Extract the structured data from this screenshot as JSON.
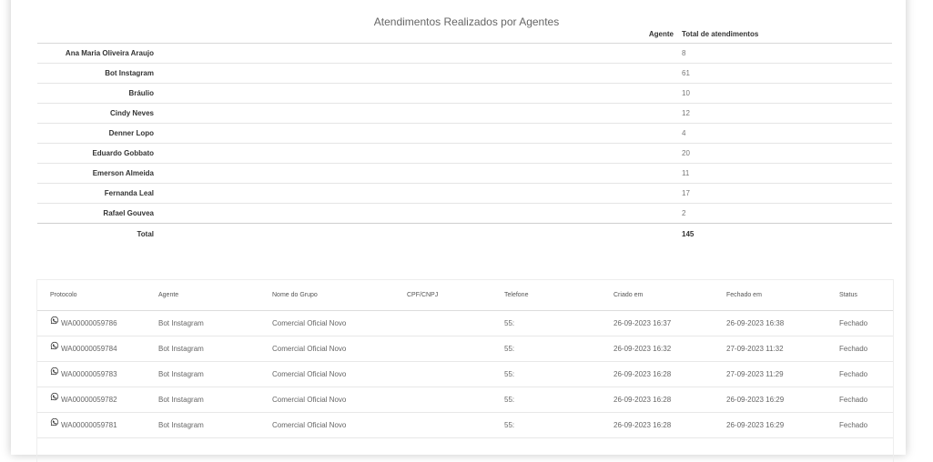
{
  "report_title": "Atendimentos Realizados por Agentes",
  "summary": {
    "headers": {
      "agent": "Agente",
      "total": "Total de atendimentos"
    },
    "rows": [
      {
        "name": "Ana Maria Oliveira Araujo",
        "total": "8"
      },
      {
        "name": "Bot Instagram",
        "total": "61"
      },
      {
        "name": "Bráulio",
        "total": "10"
      },
      {
        "name": "Cindy Neves",
        "total": "12"
      },
      {
        "name": "Denner Lopo",
        "total": "4"
      },
      {
        "name": "Eduardo Gobbato",
        "total": "20"
      },
      {
        "name": "Emerson Almeida",
        "total": "11"
      },
      {
        "name": "Fernanda Leal",
        "total": "17"
      },
      {
        "name": "Rafael Gouvea",
        "total": "2"
      }
    ],
    "total_label": "Total",
    "total_value": "145"
  },
  "detail": {
    "headers": {
      "protocolo": "Protocolo",
      "agente": "Agente",
      "grupo": "Nome do Grupo",
      "cpf": "CPF/CNPJ",
      "telefone": "Telefone",
      "criado": "Criado em",
      "fechado": "Fechado em",
      "status": "Status"
    },
    "icon": "whatsapp-icon",
    "rows": [
      {
        "protocolo": "WA00000059786",
        "agente": "Bot Instagram",
        "grupo": "Comercial Oficial Novo",
        "cpf": "",
        "telefone": "55:",
        "criado": "26-09-2023 16:37",
        "fechado": "26-09-2023 16:38",
        "status": "Fechado"
      },
      {
        "protocolo": "WA00000059784",
        "agente": "Bot Instagram",
        "grupo": "Comercial Oficial Novo",
        "cpf": "",
        "telefone": "55:",
        "criado": "26-09-2023 16:32",
        "fechado": "27-09-2023 11:32",
        "status": "Fechado"
      },
      {
        "protocolo": "WA00000059783",
        "agente": "Bot Instagram",
        "grupo": "Comercial Oficial Novo",
        "cpf": "",
        "telefone": "55:",
        "criado": "26-09-2023 16:28",
        "fechado": "27-09-2023 11:29",
        "status": "Fechado"
      },
      {
        "protocolo": "WA00000059782",
        "agente": "Bot Instagram",
        "grupo": "Comercial Oficial Novo",
        "cpf": "",
        "telefone": "55:",
        "criado": "26-09-2023 16:28",
        "fechado": "26-09-2023 16:29",
        "status": "Fechado"
      },
      {
        "protocolo": "WA00000059781",
        "agente": "Bot Instagram",
        "grupo": "Comercial Oficial Novo",
        "cpf": "",
        "telefone": "55:",
        "criado": "26-09-2023 16:28",
        "fechado": "26-09-2023 16:29",
        "status": "Fechado"
      }
    ]
  }
}
